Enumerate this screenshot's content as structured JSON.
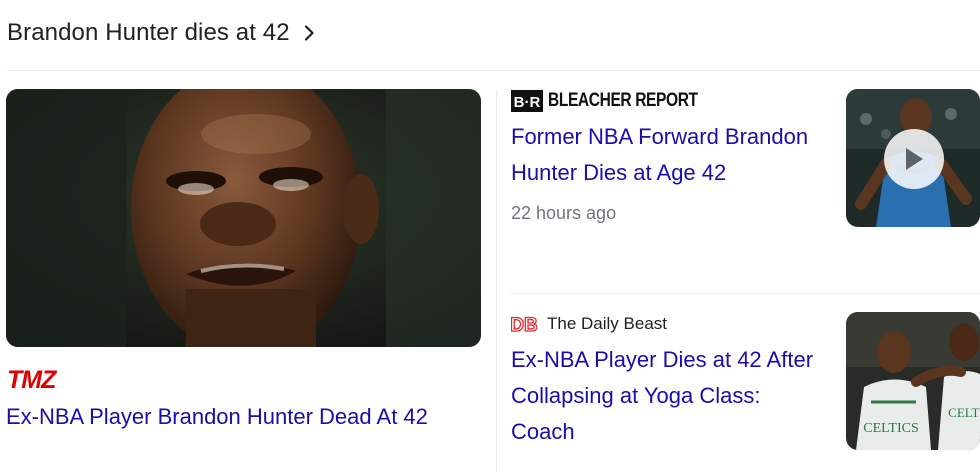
{
  "heading": {
    "title": "Brandon Hunter dies at 42",
    "chevron_icon": "chevron-right-icon"
  },
  "main_article": {
    "source_logo_text": "TMZ",
    "source_color": "#e00000",
    "title": "Ex-NBA Player Brandon Hunter Dead At 42"
  },
  "side_articles": [
    {
      "source_logo_text": "B·R",
      "source_name": "BLEACHER REPORT",
      "title": "Former NBA Forward Brandon Hunter Dies at Age 42",
      "time": "22 hours ago",
      "has_video": true,
      "play_icon": "play-icon"
    },
    {
      "source_logo_text": "DB",
      "source_name": "The Daily Beast",
      "source_color": "#e4252b",
      "title": "Ex-NBA Player Dies at 42 After Collapsing at Yoga Class: Coach",
      "has_video": false
    }
  ],
  "colors": {
    "link": "#1a0dab",
    "text": "#202124",
    "muted": "#70757a",
    "divider": "#e8eaed"
  }
}
